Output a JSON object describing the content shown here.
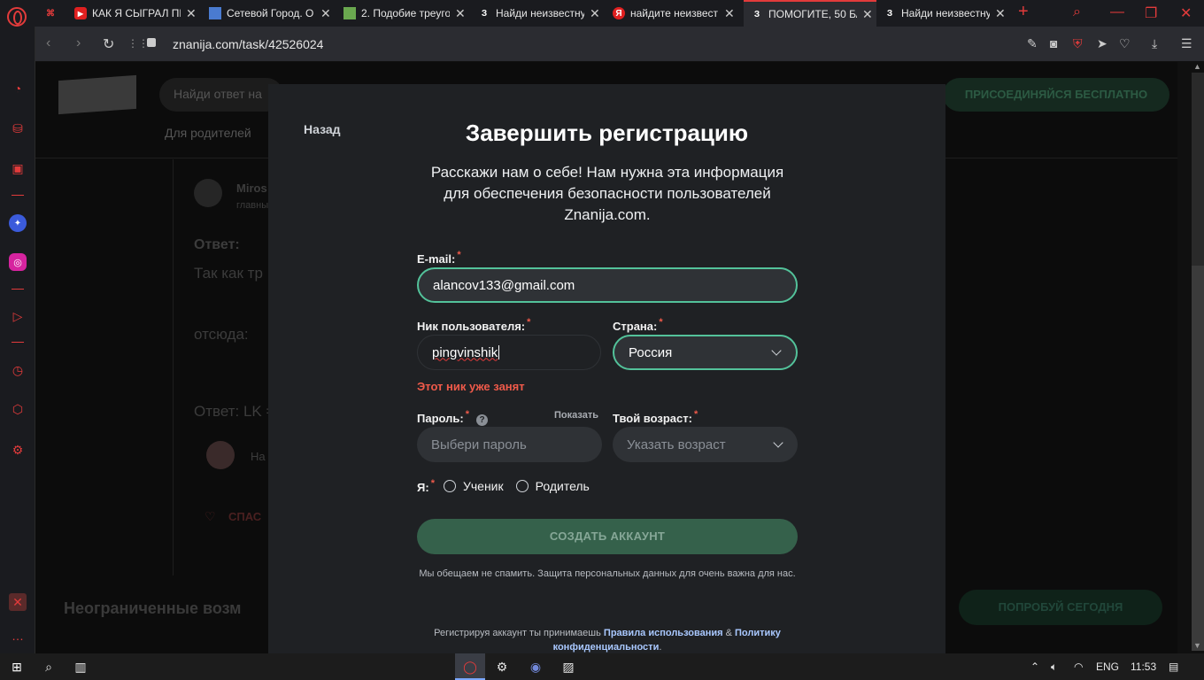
{
  "browser": {
    "tabs": [
      {
        "title": "КАК Я СЫГРАЛ ПР",
        "icon": "youtube-icon"
      },
      {
        "title": "Сетевой Город. О",
        "icon": "netcity-icon"
      },
      {
        "title": "2. Подобие треуго",
        "icon": "book-icon"
      },
      {
        "title": "Найди неизвестну",
        "icon": "znanija-icon"
      },
      {
        "title": "найдите неизвест",
        "icon": "yandex-icon"
      },
      {
        "title": "ПОМОГИТЕ, 50 БА",
        "icon": "znanija-icon",
        "active": true
      },
      {
        "title": "Найди неизвестну",
        "icon": "znanija-icon"
      }
    ],
    "url": "znanija.com/task/42526024"
  },
  "background_page": {
    "search_placeholder": "Найди ответ на",
    "join_button": "ПРИСОЕДИНЯЙСЯ БЕСПЛАТНО",
    "for_parents": "Для родителей",
    "author_name": "Miros",
    "author_rank": "главны",
    "answer_label": "Ответ:",
    "line1": "Так как тр",
    "line2": "отсюда:",
    "answer_line": "Ответ: LK =",
    "author2": "На",
    "thanks": "СПАС",
    "unlimited": "Неограниченные возм",
    "try_today": "ПОПРОБУЙ СЕГОДНЯ"
  },
  "modal": {
    "back": "Назад",
    "title": "Завершить регистрацию",
    "intro": "Расскажи нам о себе! Нам нужна эта информация для обеспечения безопасности пользователей Znanija.com.",
    "email_label": "E-mail:",
    "email_value": "alancov133@gmail.com",
    "nick_label": "Ник пользователя:",
    "nick_value": "pingvinshik",
    "country_label": "Страна:",
    "country_value": "Россия",
    "nick_error": "Этот ник уже занят",
    "password_label": "Пароль:",
    "password_show": "Показать",
    "password_placeholder": "Выбери пароль",
    "age_label": "Твой возраст:",
    "age_placeholder": "Указать возраст",
    "role_label": "Я:",
    "role_student": "Ученик",
    "role_parent": "Родитель",
    "create_button": "СОЗДАТЬ АККАУНТ",
    "promise": "Мы обещаем не спамить. Защита персональных данных для очень важна для нас.",
    "terms_prefix": "Регистрируя аккаунт ты принимаешь",
    "terms_rules": "Правила использования",
    "terms_and": "&",
    "terms_policy": "Политику конфиденциальности",
    "terms_suffix": ".",
    "required_mark": "*"
  },
  "taskbar": {
    "lang": "ENG",
    "time": "11:53"
  },
  "colors": {
    "accent_green": "#53c29a",
    "error_red": "#ef5a4a",
    "opera_red": "#e23b3b"
  }
}
